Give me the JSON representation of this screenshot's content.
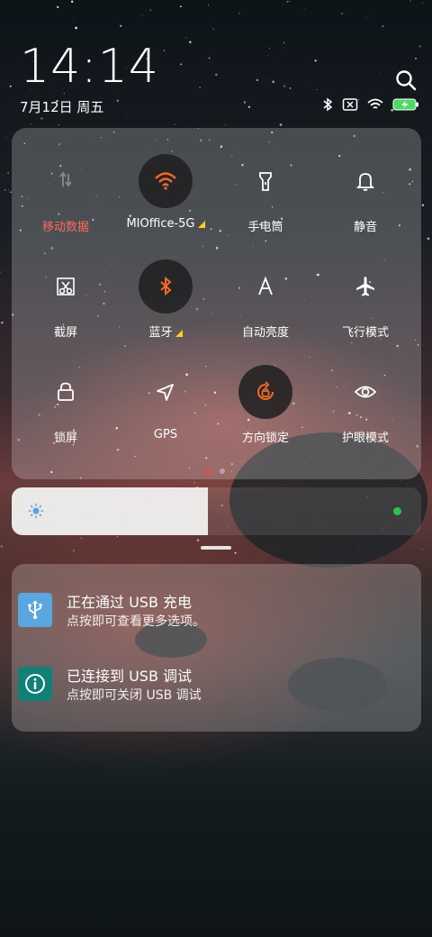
{
  "status": {
    "time": "14:14",
    "date": "7月12日 周五"
  },
  "quick_settings": [
    {
      "id": "mobile-data",
      "label": "移动数据",
      "active": false,
      "icon": "mobile-data-icon",
      "label_color": "#ff6a5a"
    },
    {
      "id": "wifi",
      "label": "MIOffice-5G",
      "active": true,
      "icon": "wifi-icon",
      "has_triangle": true
    },
    {
      "id": "flashlight",
      "label": "手电筒",
      "active": false,
      "icon": "flashlight-icon"
    },
    {
      "id": "mute",
      "label": "静音",
      "active": false,
      "icon": "bell-icon"
    },
    {
      "id": "screenshot",
      "label": "截屏",
      "active": false,
      "icon": "scissors-icon"
    },
    {
      "id": "bluetooth",
      "label": "蓝牙",
      "active": true,
      "icon": "bluetooth-icon",
      "has_triangle": true
    },
    {
      "id": "auto-brightness",
      "label": "自动亮度",
      "active": false,
      "icon": "auto-brightness-icon"
    },
    {
      "id": "airplane",
      "label": "飞行模式",
      "active": false,
      "icon": "airplane-icon"
    },
    {
      "id": "lock-screen",
      "label": "锁屏",
      "active": false,
      "icon": "lock-icon"
    },
    {
      "id": "gps",
      "label": "GPS",
      "active": false,
      "icon": "gps-icon"
    },
    {
      "id": "rotation-lock",
      "label": "方向锁定",
      "active": true,
      "icon": "rotation-lock-icon"
    },
    {
      "id": "eye-care",
      "label": "护眼模式",
      "active": false,
      "icon": "eye-icon"
    }
  ],
  "brightness": {
    "level": 0.48
  },
  "notifications": [
    {
      "title": "正在通过 USB 充电",
      "body": "点按即可查看更多选项。",
      "icon": "usb-icon",
      "color": "#5aa7e0"
    },
    {
      "title": "已连接到 USB 调试",
      "body": "点按即可关闭 USB 调试",
      "icon": "info-icon",
      "color": "#118177"
    }
  ],
  "colors": {
    "accent_orange": "#f26b28",
    "page_dot_active": "#e34d3f",
    "brightness_indicator": "#2ec04a"
  }
}
